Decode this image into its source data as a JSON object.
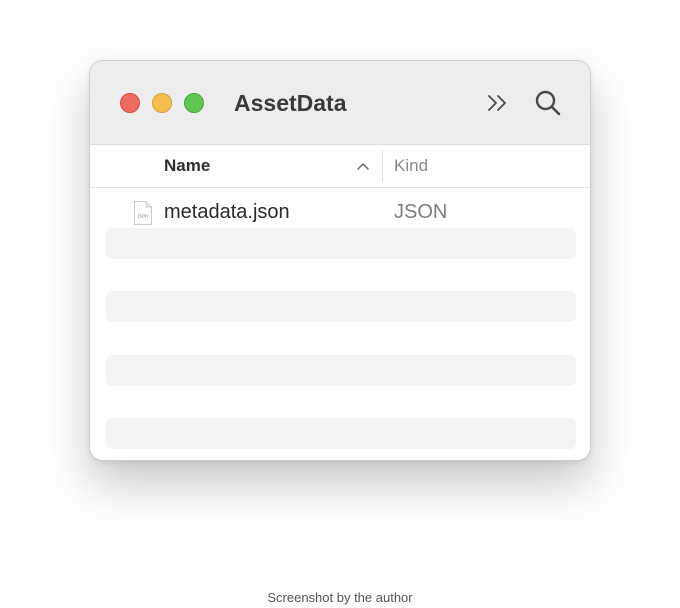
{
  "window": {
    "title": "AssetData",
    "colors": {
      "close": "#ec6a5e",
      "minimize": "#f4bf4f",
      "zoom": "#61c554"
    },
    "toolbar": {
      "overflow_icon": "double-chevron-right-icon",
      "search_icon": "magnifying-glass-icon"
    }
  },
  "columns": {
    "name_label": "Name",
    "kind_label": "Kind",
    "sort_icon": "chevron-up-icon"
  },
  "files": [
    {
      "icon": "json-file-icon",
      "icon_text": "json",
      "name": "metadata.json",
      "kind": "JSON"
    }
  ],
  "caption": "Screenshot by the author"
}
